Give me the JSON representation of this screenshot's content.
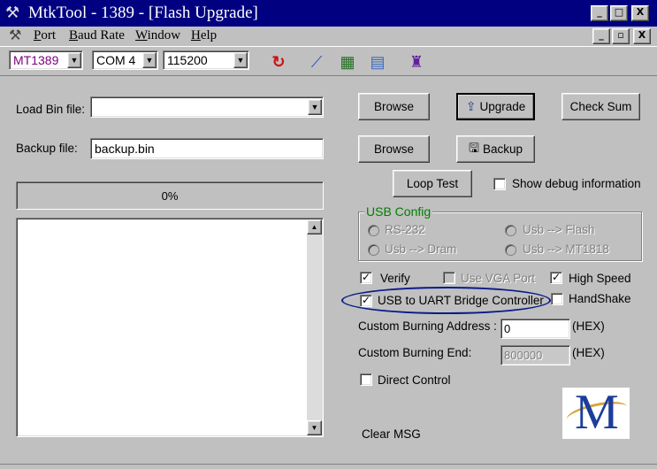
{
  "window": {
    "title": "MtkTool - 1389 - [Flash Upgrade]",
    "controls": {
      "minimize": "_",
      "maximize": "□",
      "close": "X",
      "restore": "▫"
    }
  },
  "menu": [
    {
      "label": "Port",
      "underline": "P"
    },
    {
      "label": "Baud Rate",
      "underline": "B"
    },
    {
      "label": "Window",
      "underline": "W"
    },
    {
      "label": "Help",
      "underline": "H"
    }
  ],
  "toolbar": {
    "chip_select": "MT1389",
    "port_select": "COM 4",
    "baud_select": "115200",
    "icons": [
      "connect-icon",
      "chart-icon",
      "calculator-icon",
      "notepad-icon",
      "usb-icon"
    ]
  },
  "form": {
    "load_bin_label": "Load Bin file:",
    "load_bin_value": "",
    "backup_label": "Backup file:",
    "backup_value": "backup.bin",
    "progress_text": "0%",
    "progress_fraction": 0
  },
  "buttons": {
    "browse1": "Browse",
    "upgrade": "Upgrade",
    "check_sum": "Check Sum",
    "browse2": "Browse",
    "backup": "Backup",
    "loop_test": "Loop Test"
  },
  "options": {
    "show_debug": {
      "label": "Show debug information",
      "checked": false
    },
    "verify": {
      "label": "Verify",
      "checked": true
    },
    "use_vga": {
      "label": "Use VGA Port",
      "checked": false
    },
    "high_speed": {
      "label": "High Speed",
      "checked": true
    },
    "usb_uart": {
      "label": "USB to UART Bridge Controller",
      "checked": true
    },
    "handshake": {
      "label": "HandShake",
      "checked": false
    },
    "direct_control": {
      "label": "Direct Control",
      "checked": false
    }
  },
  "usb_config": {
    "title": "USB Config",
    "radios": [
      "RS-232",
      "Usb --> Flash",
      "Usb --> Dram",
      "Usb --> MT1818"
    ]
  },
  "burning": {
    "address_label": "Custom Burning  Address :",
    "address_value": "0",
    "address_unit": "(HEX)",
    "end_label": "Custom Burning  End:",
    "end_value": "800000",
    "end_unit": "(HEX)"
  },
  "clear_msg": "Clear MSG",
  "logo_letter": "M",
  "colors": {
    "titlebar": "#000080",
    "highlight_ellipse": "#0a1a8a",
    "logo_blue": "#1c3d9c",
    "logo_gold": "#d8a43a"
  }
}
